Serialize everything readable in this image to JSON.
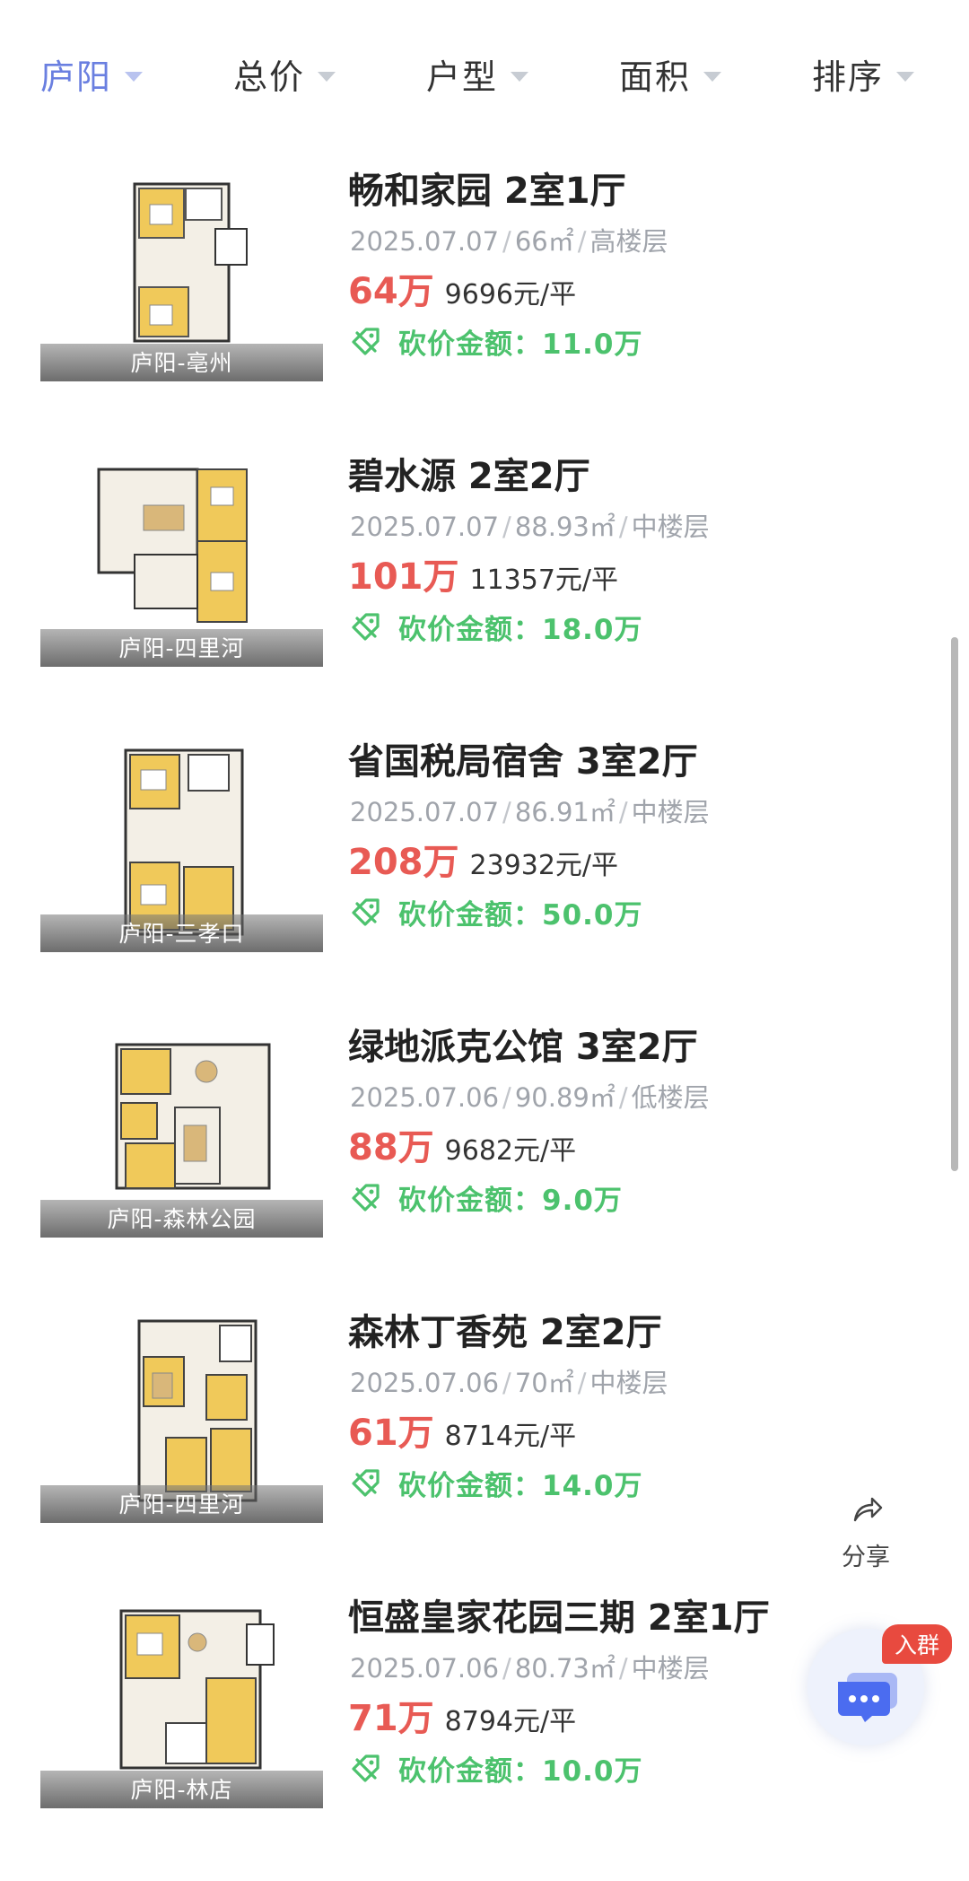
{
  "filters": [
    {
      "label": "庐阳",
      "active": true
    },
    {
      "label": "总价",
      "active": false
    },
    {
      "label": "户型",
      "active": false
    },
    {
      "label": "面积",
      "active": false
    },
    {
      "label": "排序",
      "active": false
    }
  ],
  "listings": [
    {
      "title": "畅和家园 2室1厅",
      "date": "2025.07.07",
      "area": "66㎡",
      "floor": "高楼层",
      "price": "64万",
      "unit_price": "9696元/平",
      "cut_label": "砍价金额：",
      "cut_value": "11.0万",
      "location": "庐阳-亳州"
    },
    {
      "title": "碧水源 2室2厅",
      "date": "2025.07.07",
      "area": "88.93㎡",
      "floor": "中楼层",
      "price": "101万",
      "unit_price": "11357元/平",
      "cut_label": "砍价金额：",
      "cut_value": "18.0万",
      "location": "庐阳-四里河"
    },
    {
      "title": "省国税局宿舍 3室2厅",
      "date": "2025.07.07",
      "area": "86.91㎡",
      "floor": "中楼层",
      "price": "208万",
      "unit_price": "23932元/平",
      "cut_label": "砍价金额：",
      "cut_value": "50.0万",
      "location": "庐阳-三孝口"
    },
    {
      "title": "绿地派克公馆 3室2厅",
      "date": "2025.07.06",
      "area": "90.89㎡",
      "floor": "低楼层",
      "price": "88万",
      "unit_price": "9682元/平",
      "cut_label": "砍价金额：",
      "cut_value": "9.0万",
      "location": "庐阳-森林公园"
    },
    {
      "title": "森林丁香苑 2室2厅",
      "date": "2025.07.06",
      "area": "70㎡",
      "floor": "中楼层",
      "price": "61万",
      "unit_price": "8714元/平",
      "cut_label": "砍价金额：",
      "cut_value": "14.0万",
      "location": "庐阳-四里河"
    },
    {
      "title": "恒盛皇家花园三期 2室1厅",
      "date": "2025.07.06",
      "area": "80.73㎡",
      "floor": "中楼层",
      "price": "71万",
      "unit_price": "8794元/平",
      "cut_label": "砍价金额：",
      "cut_value": "10.0万",
      "location": "庐阳-林店"
    }
  ],
  "floating": {
    "share_label": "分享",
    "share_icon": "share-arrow-icon",
    "group_badge": "入群",
    "group_icon": "chat-bubble-icon"
  },
  "colors": {
    "accent": "#6a7fe0",
    "price": "#e85a54",
    "cut": "#4cc26d",
    "badge": "#e84a3f"
  }
}
